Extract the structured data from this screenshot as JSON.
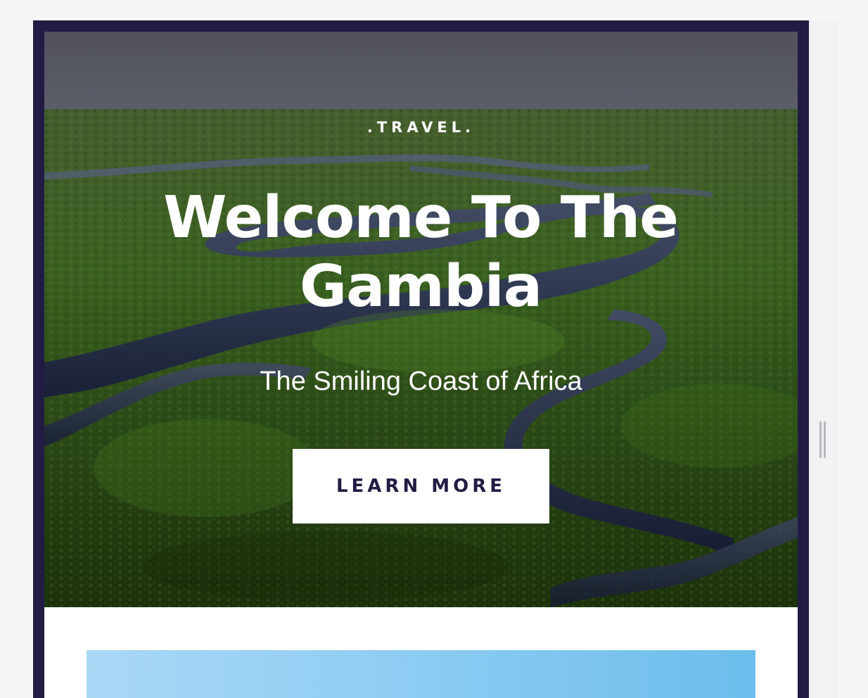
{
  "hero": {
    "eyebrow": ".TRAVEL.",
    "title": "Welcome To The Gambia",
    "subtitle": "The Smiling Coast of Africa",
    "cta_label": "LEARN MORE"
  },
  "colors": {
    "frame": "#221c44",
    "cta_background": "#ffffff",
    "cta_text": "#221c44",
    "hero_text": "#ffffff",
    "page_background": "#f4f5f5"
  }
}
